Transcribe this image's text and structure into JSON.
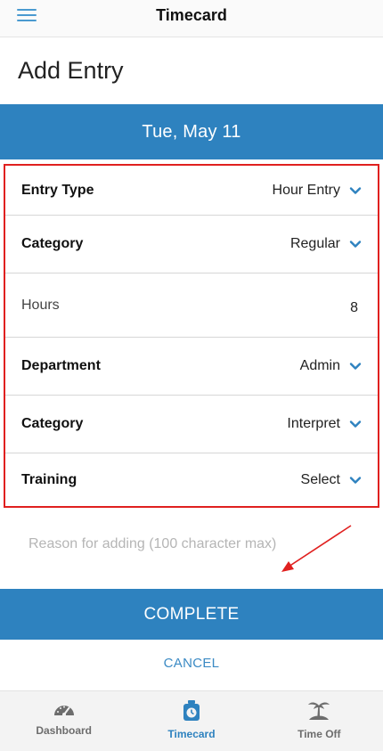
{
  "header": {
    "menu_icon": "hamburger-menu-icon",
    "title": "Timecard"
  },
  "page": {
    "heading": "Add Entry",
    "date": "Tue, May 11"
  },
  "form": {
    "rows": [
      {
        "label": "Entry Type",
        "value": "Hour Entry",
        "dropdown": true
      },
      {
        "label": "Category",
        "value": "Regular",
        "dropdown": true
      },
      {
        "label": "Hours",
        "value": "8",
        "dropdown": false
      },
      {
        "label": "Department",
        "value": "Admin",
        "dropdown": true
      },
      {
        "label": "Category",
        "value": "Interpret",
        "dropdown": true
      },
      {
        "label": "Training",
        "value": "Select",
        "dropdown": true
      }
    ],
    "reason_placeholder": "Reason for adding (100 character max)"
  },
  "actions": {
    "complete_label": "COMPLETE",
    "cancel_label": "CANCEL"
  },
  "tabbar": {
    "tabs": [
      {
        "label": "Dashboard",
        "icon": "speedometer-icon",
        "active": false
      },
      {
        "label": "Timecard",
        "icon": "stopwatch-icon",
        "active": true
      },
      {
        "label": "Time Off",
        "icon": "island-palm-icon",
        "active": false
      }
    ]
  },
  "colors": {
    "primary": "#2e82bf",
    "annotation_red": "#e0201f",
    "chevron": "#2e82bf"
  }
}
